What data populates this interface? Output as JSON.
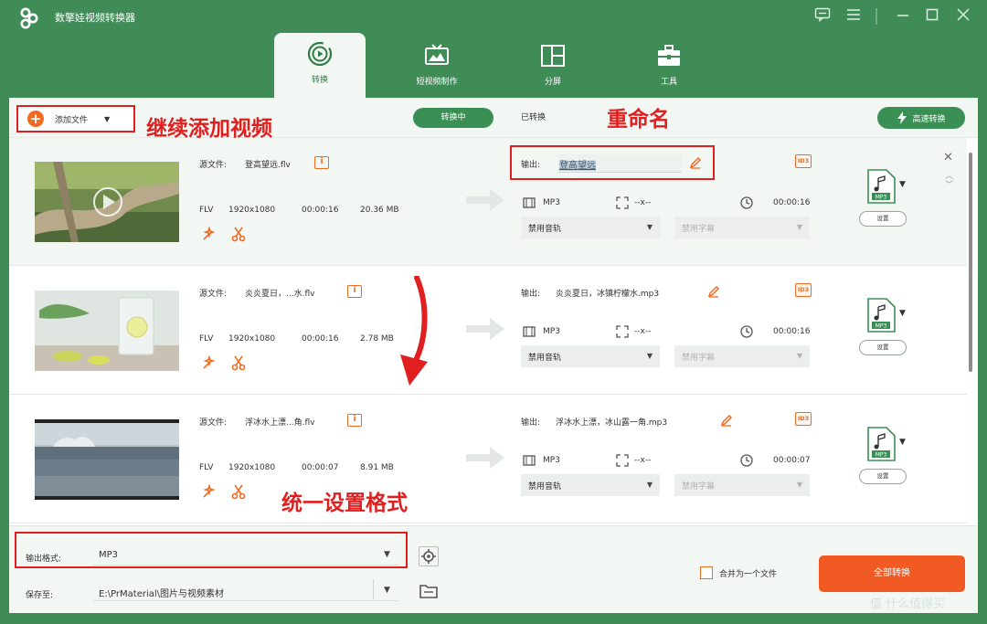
{
  "app": {
    "title": "数擎娃视频转换器"
  },
  "tabs": [
    {
      "label": "转换",
      "icon": "convert-icon",
      "active": true
    },
    {
      "label": "短视频制作",
      "icon": "tv-icon",
      "active": false
    },
    {
      "label": "分屏",
      "icon": "split-screen-icon",
      "active": false
    },
    {
      "label": "工具",
      "icon": "toolbox-icon",
      "active": false
    }
  ],
  "toolbar": {
    "add_file_label": "添加文件",
    "converting_label": "转换中",
    "converted_label": "已转换",
    "speed_convert_label": "高速转换"
  },
  "annotations": {
    "add_more": "继续添加视频",
    "rename": "重命名",
    "unify_format": "统一设置格式"
  },
  "labels": {
    "source": "源文件:",
    "output": "输出:",
    "settings": "设置"
  },
  "files": [
    {
      "source_name": "登高望远.flv",
      "format": "FLV",
      "resolution": "1920x1080",
      "duration": "00:00:16",
      "size": "20.36 MB",
      "output_name": "登高望远",
      "output_format": "MP3",
      "output_resolution": "--x--",
      "output_duration": "00:00:16",
      "audio_track": "禁用音轨",
      "subtitle": "禁用字幕"
    },
    {
      "source_name": "炎炎夏日，...水.flv",
      "format": "FLV",
      "resolution": "1920x1080",
      "duration": "00:00:16",
      "size": "2.78 MB",
      "output_name": "炎炎夏日，冰镇柠檬水.mp3",
      "output_format": "MP3",
      "output_resolution": "--x--",
      "output_duration": "00:00:16",
      "audio_track": "禁用音轨",
      "subtitle": "禁用字幕"
    },
    {
      "source_name": "浮冰水上漂...角.flv",
      "format": "FLV",
      "resolution": "1920x1080",
      "duration": "00:00:07",
      "size": "8.91 MB",
      "output_name": "浮冰水上漂，冰山露一角.mp3",
      "output_format": "MP3",
      "output_resolution": "--x--",
      "output_duration": "00:00:07",
      "audio_track": "禁用音轨",
      "subtitle": "禁用字幕"
    }
  ],
  "bottom": {
    "output_format_label": "输出格式:",
    "output_format_value": "MP3",
    "save_to_label": "保存至:",
    "save_to_value": "E:\\PrMaterial\\图片与视频素材",
    "merge_label": "合并为一个文件",
    "convert_all_label": "全部转换"
  },
  "watermark": "值 什么值得买",
  "colors": {
    "brand_green": "#3f8c57",
    "accent_orange": "#f15a22",
    "annotation_red": "#e02020"
  }
}
